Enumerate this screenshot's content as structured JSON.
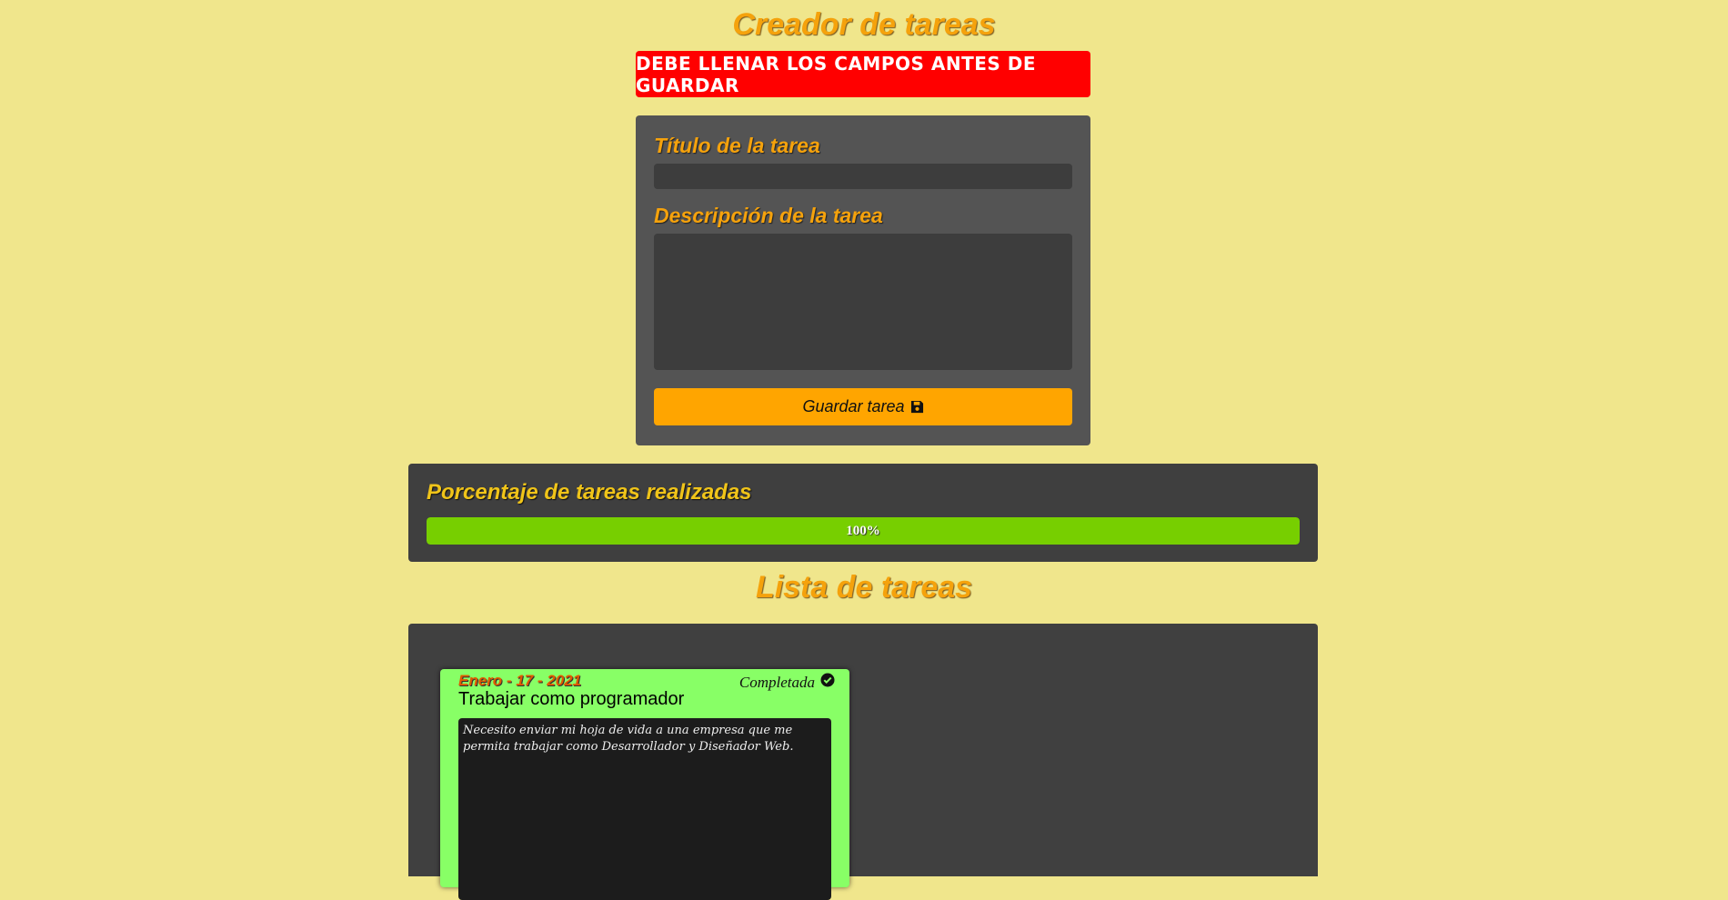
{
  "header": {
    "title": "Creador de tareas"
  },
  "alert": {
    "message": "DEBE LLENAR LOS CAMPOS ANTES DE GUARDAR",
    "color": "#ff0000"
  },
  "form": {
    "title_label": "Título de la tarea",
    "title_value": "",
    "description_label": "Descripción de la tarea",
    "description_value": "",
    "save_label": "Guardar tarea",
    "save_icon": "floppy-disk-icon",
    "save_color": "#ffa500"
  },
  "progress": {
    "title": "Porcentaje de tareas realizadas",
    "value_text": "100%",
    "percent": 100,
    "fill_color": "#77cf00"
  },
  "list": {
    "title": "Lista de tareas",
    "tasks": [
      {
        "date": "Enero - 17 - 2021",
        "status": "Completada",
        "status_icon": "check-circle-icon",
        "title": "Trabajar como programador",
        "description": "Necesito enviar mi hoja de vida a una empresa que me permita trabajar como Desarrollador y Diseñador Web.",
        "card_color": "#88ff66"
      }
    ]
  },
  "colors": {
    "page_background": "#f0e68c",
    "accent": "#f5a20c"
  }
}
